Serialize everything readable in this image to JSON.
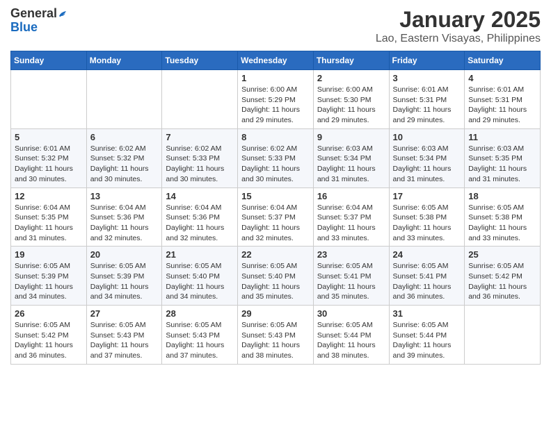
{
  "header": {
    "logo": {
      "line1": "General",
      "line2": "Blue"
    },
    "title": "January 2025",
    "subtitle": "Lao, Eastern Visayas, Philippines"
  },
  "calendar": {
    "days_of_week": [
      "Sunday",
      "Monday",
      "Tuesday",
      "Wednesday",
      "Thursday",
      "Friday",
      "Saturday"
    ],
    "weeks": [
      [
        {
          "day": "",
          "info": ""
        },
        {
          "day": "",
          "info": ""
        },
        {
          "day": "",
          "info": ""
        },
        {
          "day": "1",
          "info": "Sunrise: 6:00 AM\nSunset: 5:29 PM\nDaylight: 11 hours and 29 minutes."
        },
        {
          "day": "2",
          "info": "Sunrise: 6:00 AM\nSunset: 5:30 PM\nDaylight: 11 hours and 29 minutes."
        },
        {
          "day": "3",
          "info": "Sunrise: 6:01 AM\nSunset: 5:31 PM\nDaylight: 11 hours and 29 minutes."
        },
        {
          "day": "4",
          "info": "Sunrise: 6:01 AM\nSunset: 5:31 PM\nDaylight: 11 hours and 29 minutes."
        }
      ],
      [
        {
          "day": "5",
          "info": "Sunrise: 6:01 AM\nSunset: 5:32 PM\nDaylight: 11 hours and 30 minutes."
        },
        {
          "day": "6",
          "info": "Sunrise: 6:02 AM\nSunset: 5:32 PM\nDaylight: 11 hours and 30 minutes."
        },
        {
          "day": "7",
          "info": "Sunrise: 6:02 AM\nSunset: 5:33 PM\nDaylight: 11 hours and 30 minutes."
        },
        {
          "day": "8",
          "info": "Sunrise: 6:02 AM\nSunset: 5:33 PM\nDaylight: 11 hours and 30 minutes."
        },
        {
          "day": "9",
          "info": "Sunrise: 6:03 AM\nSunset: 5:34 PM\nDaylight: 11 hours and 31 minutes."
        },
        {
          "day": "10",
          "info": "Sunrise: 6:03 AM\nSunset: 5:34 PM\nDaylight: 11 hours and 31 minutes."
        },
        {
          "day": "11",
          "info": "Sunrise: 6:03 AM\nSunset: 5:35 PM\nDaylight: 11 hours and 31 minutes."
        }
      ],
      [
        {
          "day": "12",
          "info": "Sunrise: 6:04 AM\nSunset: 5:35 PM\nDaylight: 11 hours and 31 minutes."
        },
        {
          "day": "13",
          "info": "Sunrise: 6:04 AM\nSunset: 5:36 PM\nDaylight: 11 hours and 32 minutes."
        },
        {
          "day": "14",
          "info": "Sunrise: 6:04 AM\nSunset: 5:36 PM\nDaylight: 11 hours and 32 minutes."
        },
        {
          "day": "15",
          "info": "Sunrise: 6:04 AM\nSunset: 5:37 PM\nDaylight: 11 hours and 32 minutes."
        },
        {
          "day": "16",
          "info": "Sunrise: 6:04 AM\nSunset: 5:37 PM\nDaylight: 11 hours and 33 minutes."
        },
        {
          "day": "17",
          "info": "Sunrise: 6:05 AM\nSunset: 5:38 PM\nDaylight: 11 hours and 33 minutes."
        },
        {
          "day": "18",
          "info": "Sunrise: 6:05 AM\nSunset: 5:38 PM\nDaylight: 11 hours and 33 minutes."
        }
      ],
      [
        {
          "day": "19",
          "info": "Sunrise: 6:05 AM\nSunset: 5:39 PM\nDaylight: 11 hours and 34 minutes."
        },
        {
          "day": "20",
          "info": "Sunrise: 6:05 AM\nSunset: 5:39 PM\nDaylight: 11 hours and 34 minutes."
        },
        {
          "day": "21",
          "info": "Sunrise: 6:05 AM\nSunset: 5:40 PM\nDaylight: 11 hours and 34 minutes."
        },
        {
          "day": "22",
          "info": "Sunrise: 6:05 AM\nSunset: 5:40 PM\nDaylight: 11 hours and 35 minutes."
        },
        {
          "day": "23",
          "info": "Sunrise: 6:05 AM\nSunset: 5:41 PM\nDaylight: 11 hours and 35 minutes."
        },
        {
          "day": "24",
          "info": "Sunrise: 6:05 AM\nSunset: 5:41 PM\nDaylight: 11 hours and 36 minutes."
        },
        {
          "day": "25",
          "info": "Sunrise: 6:05 AM\nSunset: 5:42 PM\nDaylight: 11 hours and 36 minutes."
        }
      ],
      [
        {
          "day": "26",
          "info": "Sunrise: 6:05 AM\nSunset: 5:42 PM\nDaylight: 11 hours and 36 minutes."
        },
        {
          "day": "27",
          "info": "Sunrise: 6:05 AM\nSunset: 5:43 PM\nDaylight: 11 hours and 37 minutes."
        },
        {
          "day": "28",
          "info": "Sunrise: 6:05 AM\nSunset: 5:43 PM\nDaylight: 11 hours and 37 minutes."
        },
        {
          "day": "29",
          "info": "Sunrise: 6:05 AM\nSunset: 5:43 PM\nDaylight: 11 hours and 38 minutes."
        },
        {
          "day": "30",
          "info": "Sunrise: 6:05 AM\nSunset: 5:44 PM\nDaylight: 11 hours and 38 minutes."
        },
        {
          "day": "31",
          "info": "Sunrise: 6:05 AM\nSunset: 5:44 PM\nDaylight: 11 hours and 39 minutes."
        },
        {
          "day": "",
          "info": ""
        }
      ]
    ]
  }
}
